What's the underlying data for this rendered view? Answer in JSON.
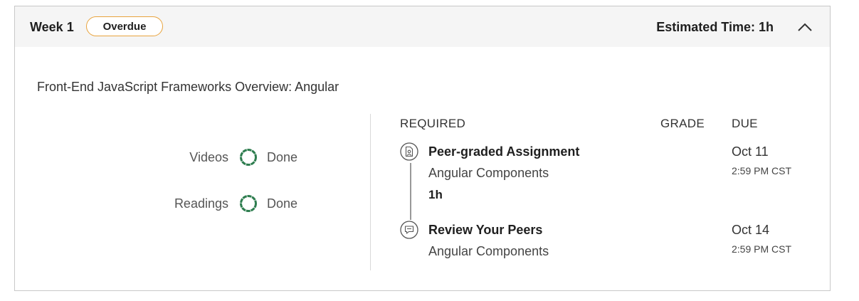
{
  "week": {
    "title": "Week 1",
    "badge": "Overdue",
    "estimated_time": "Estimated Time: 1h",
    "accent_badge_color": "#e8a33d"
  },
  "module": {
    "title": "Front-End JavaScript Frameworks Overview: Angular"
  },
  "progress": [
    {
      "label": "Videos",
      "status": "Done",
      "icon": "progress-ring-icon",
      "ring_color": "#2e7d4f"
    },
    {
      "label": "Readings",
      "status": "Done",
      "icon": "progress-ring-icon",
      "ring_color": "#2e7d4f"
    }
  ],
  "columns": {
    "required": "REQUIRED",
    "grade": "GRADE",
    "due": "DUE"
  },
  "items": [
    {
      "type": "Peer-graded Assignment",
      "name": "Angular Components",
      "duration": "1h",
      "due_date": "Oct 11",
      "due_time": "2:59 PM CST",
      "icon": "peer-assignment-icon"
    },
    {
      "type": "Review Your Peers",
      "name": "Angular Components",
      "due_date": "Oct 14",
      "due_time": "2:59 PM CST",
      "icon": "review-peers-icon"
    }
  ]
}
